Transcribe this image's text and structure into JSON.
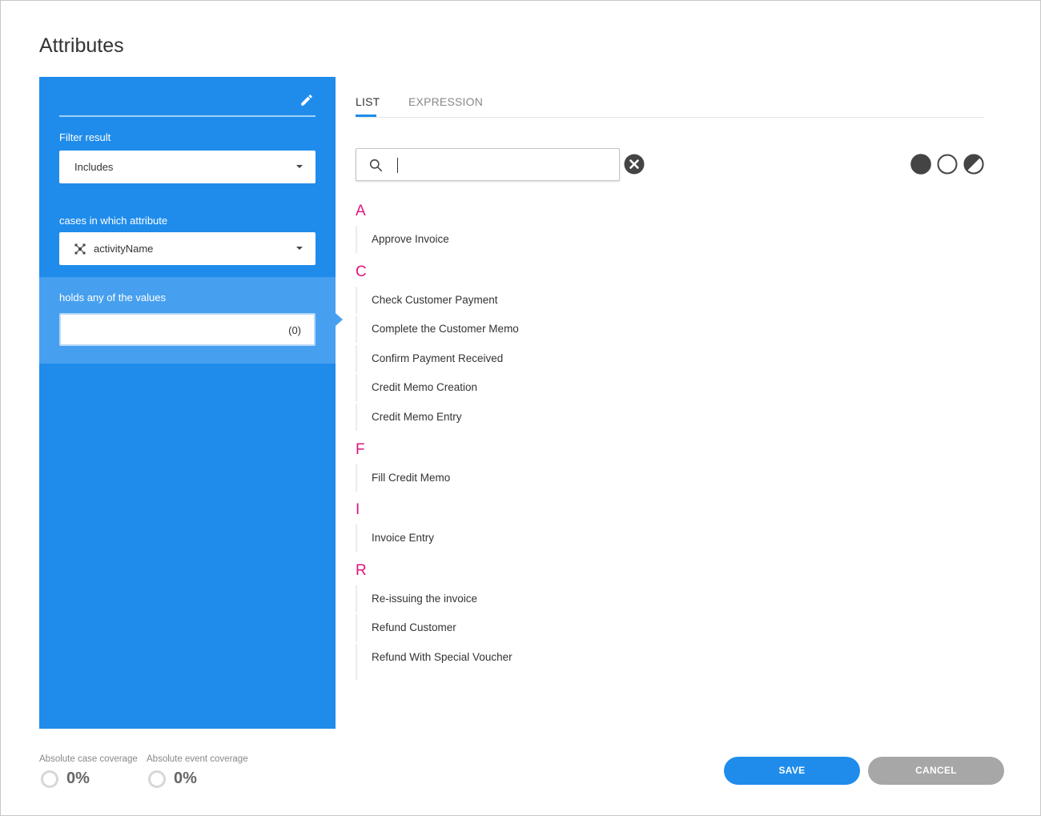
{
  "title": "Attributes",
  "filter": {
    "result_label": "Filter result",
    "result_value": "Includes",
    "attribute_label": "cases in which attribute",
    "attribute_value": "activityName",
    "values_label": "holds any of the values",
    "values_count": "(0)"
  },
  "tabs": [
    {
      "label": "LIST",
      "active": true
    },
    {
      "label": "EXPRESSION",
      "active": false
    }
  ],
  "search": {
    "value": "",
    "placeholder": ""
  },
  "groups": [
    {
      "letter": "A",
      "items": [
        "Approve Invoice"
      ]
    },
    {
      "letter": "C",
      "items": [
        "Check Customer Payment",
        "Complete the Customer Memo",
        "Confirm Payment Received",
        "Credit Memo Creation",
        "Credit Memo Entry"
      ]
    },
    {
      "letter": "F",
      "items": [
        "Fill Credit Memo"
      ]
    },
    {
      "letter": "I",
      "items": [
        "Invoice Entry"
      ]
    },
    {
      "letter": "R",
      "items": [
        "Re-issuing the invoice",
        "Refund Customer",
        "Refund With Special Voucher"
      ]
    }
  ],
  "coverage": {
    "case_label": "Absolute case coverage",
    "case_value": "0%",
    "event_label": "Absolute event coverage",
    "event_value": "0%"
  },
  "buttons": {
    "save": "SAVE",
    "cancel": "CANCEL"
  },
  "colors": {
    "accent": "#1f8ceb",
    "letter": "#e0157f",
    "cancel": "#a7a7a7"
  },
  "icons": {
    "edit": "pencil-icon",
    "attribute": "attribute-icon",
    "search": "search-icon",
    "clear": "clear-icon",
    "select_all": "select-all-icon",
    "select_none": "select-none-icon",
    "invert": "invert-selection-icon"
  }
}
